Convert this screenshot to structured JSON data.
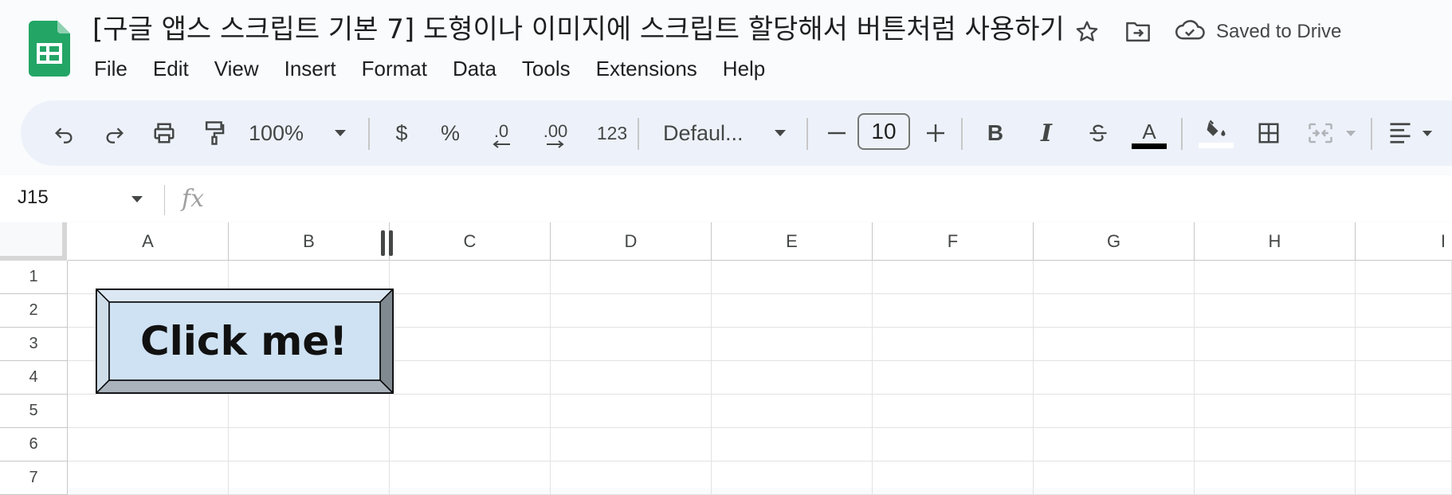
{
  "app": {
    "title": "[구글 앱스 스크립트 기본 7] 도형이나 이미지에 스크립트 할당해서 버튼처럼 사용하기",
    "saved_status": "Saved to Drive",
    "title_icons": [
      "star-icon",
      "move-to-folder-icon",
      "cloud-saved-icon"
    ]
  },
  "menu": {
    "items": [
      "File",
      "Edit",
      "View",
      "Insert",
      "Format",
      "Data",
      "Tools",
      "Extensions",
      "Help"
    ]
  },
  "toolbar": {
    "zoom": "100%",
    "currency": "$",
    "percent": "%",
    "decrease_decimal": ".0",
    "increase_decimal": ".00",
    "number_format": "123",
    "font_family": "Defaul...",
    "font_size": "10",
    "bold": "B",
    "italic": "I",
    "text_color_letter": "A",
    "text_color": "#000000",
    "fill_color": "#ffffff"
  },
  "formula_bar": {
    "cell_reference": "J15",
    "fx_label": "fx",
    "formula": ""
  },
  "sheet": {
    "columns": [
      "A",
      "B",
      "C",
      "D",
      "E",
      "F",
      "G",
      "H",
      "I"
    ],
    "rows": [
      "1",
      "2",
      "3",
      "4",
      "5",
      "6",
      "7"
    ]
  },
  "drawing": {
    "label": "Click me!",
    "face_color": "#cfe2f3",
    "top_bevel_color": "#dbe7f3",
    "side_bevel_color": "#808890",
    "bottom_bevel_color": "#a9b2bb"
  },
  "colors": {
    "sheets_green": "#0f9d58",
    "toolbar_bg": "#edf2fa",
    "page_bg": "#f9fbfd"
  }
}
